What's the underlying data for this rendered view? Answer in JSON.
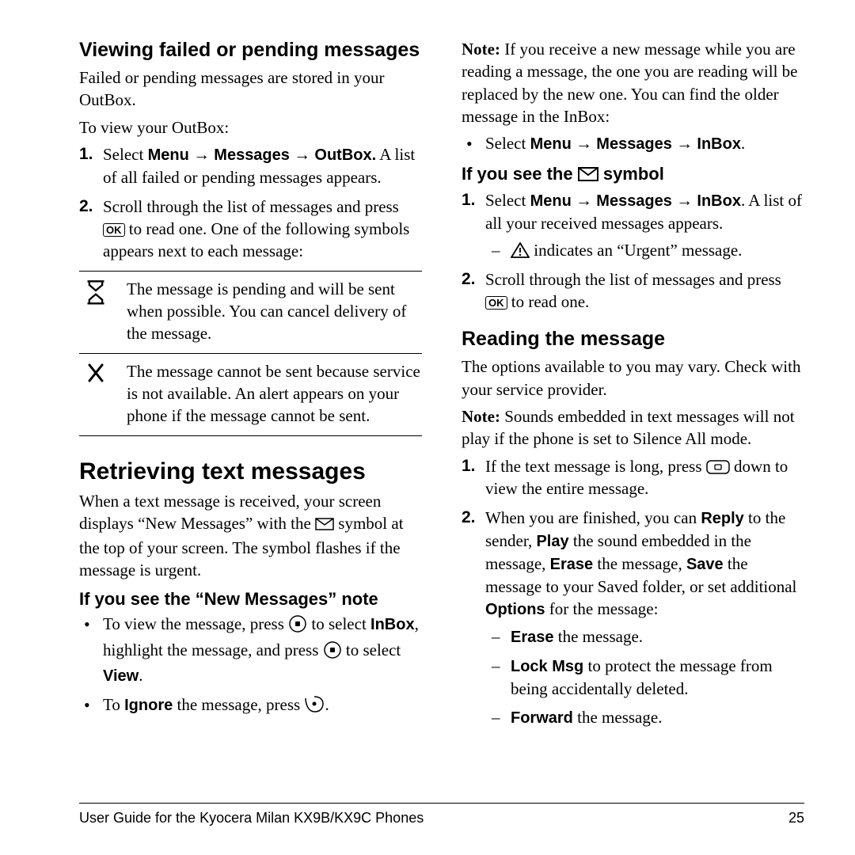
{
  "left": {
    "h2": "Viewing failed or pending messages",
    "p1": "Failed or pending messages are stored in your OutBox.",
    "p2": "To view your OutBox:",
    "step1_pre": "Select ",
    "step1_menu": "Menu",
    "step1_messages": "Messages",
    "step1_outbox": "OutBox.",
    "step1_post": " A list of all failed or pending messages appears.",
    "step2_a": "Scroll through the list of messages and press ",
    "step2_b": " to read one. One of the following symbols appears next to each message:",
    "row1": "The message is pending and will be sent when possible. You can cancel delivery of the message.",
    "row2": "The message cannot be sent because service is not available. An alert appears on your phone if the message cannot be sent.",
    "h1": "Retrieving text messages",
    "p3a": "When a text message is received, your screen displays “New Messages” with the ",
    "p3b": " symbol at the top of your screen. The symbol flashes if the message is urgent.",
    "h3": "If you see the “New Messages” note",
    "b1a": "To view the message, press ",
    "b1b": " to select ",
    "b1_inbox": "InBox",
    "b1c": ", highlight the message, and press ",
    "b1d": " to select ",
    "b1_view": "View",
    "b2a": "To ",
    "b2_ignore": "Ignore",
    "b2b": " the message, press "
  },
  "right": {
    "note1_lbl": "Note:",
    "note1": "  If you receive a new message while you are reading a message, the one you are reading will be replaced by the new one. You can find the older message in the InBox:",
    "b1_pre": "Select ",
    "menu": "Menu",
    "messages": "Messages",
    "inbox": "InBox",
    "h3a": "If you see the ",
    "h3b": " symbol",
    "s1_pre": "Select ",
    "s1_post": ". A list of all your received messages appears.",
    "dash1": " indicates an “Urgent” message.",
    "s2a": "Scroll through the list of messages and press ",
    "s2b": " to read one.",
    "h2": "Reading the message",
    "p1": "The options available to you may vary. Check with your service provider.",
    "note2_lbl": "Note:",
    "note2": "  Sounds embedded in text messages will not play if the phone is set to Silence All mode.",
    "r1a": "If the text message is long, press ",
    "r1b": " down to view the entire message.",
    "r2a": "When you are finished, you can ",
    "reply": "Reply",
    "r2b": " to the sender, ",
    "play": "Play",
    "r2c": " the sound embedded in the message, ",
    "erase": "Erase",
    "r2d": " the message, ",
    "save": "Save",
    "r2e": " the message to your Saved folder, or set additional ",
    "options": "Options",
    "r2f": " for the message:",
    "d1a": "Erase",
    "d1b": " the message.",
    "d2a": "Lock Msg",
    "d2b": " to protect the message from being accidentally deleted.",
    "d3a": "Forward",
    "d3b": " the message."
  },
  "footer": {
    "left": "User Guide for the Kyocera Milan KX9B/KX9C Phones",
    "right": "25"
  },
  "arrow": "→"
}
